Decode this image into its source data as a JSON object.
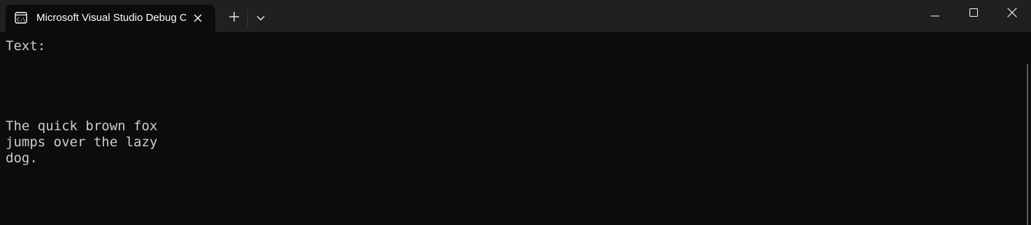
{
  "window": {
    "tab_title": "Microsoft Visual Studio Debug Console",
    "icons": {
      "tab": "console-icon",
      "tab_close": "close-icon",
      "new_tab": "plus-icon",
      "dropdown": "chevron-down-icon",
      "minimize": "minimize-icon",
      "maximize": "maximize-icon",
      "close": "close-icon"
    }
  },
  "console": {
    "lines": [
      "Text:",
      "",
      "",
      "",
      "",
      "The quick brown fox",
      "jumps over the lazy",
      "dog."
    ]
  },
  "colors": {
    "titlebar": "#202020",
    "background": "#0c0c0c",
    "text": "#cccccc"
  }
}
